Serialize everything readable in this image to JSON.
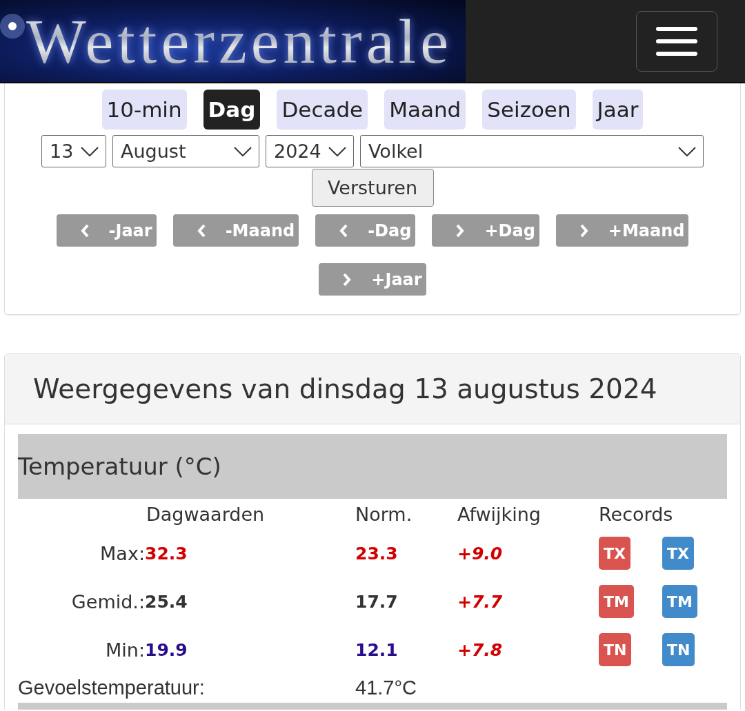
{
  "header": {
    "logo": "Wetterzentrale"
  },
  "period_tabs": [
    {
      "label": "10-min",
      "selected": false
    },
    {
      "label": "Dag",
      "selected": true
    },
    {
      "label": "Decade",
      "selected": false
    },
    {
      "label": "Maand",
      "selected": false
    },
    {
      "label": "Seizoen",
      "selected": false
    },
    {
      "label": "Jaar",
      "selected": false
    }
  ],
  "selects": [
    {
      "value": "13"
    },
    {
      "value": "August"
    },
    {
      "value": "2024"
    },
    {
      "value": "Volkel"
    }
  ],
  "submit_button": "Versturen",
  "nav_buttons": [
    {
      "label": "-Jaar",
      "kind": "prev"
    },
    {
      "label": "-Maand",
      "kind": "prev"
    },
    {
      "label": "-Dag",
      "kind": "prev"
    },
    {
      "label": "+Dag",
      "kind": "next"
    },
    {
      "label": "+Maand",
      "kind": "next"
    },
    {
      "label": "+Jaar",
      "kind": "next"
    }
  ],
  "weather_card": {
    "title": "Weergegevens van dinsdag 13 augustus 2024",
    "section": {
      "title": "Temperatuur (°C)",
      "columns": [
        "Dagwaarden",
        "Norm.",
        "Afwijking",
        "Records"
      ],
      "rows": [
        {
          "label": "Max:",
          "value": "32.3",
          "norm": "23.3",
          "deviation": "+9.0",
          "color": "#d40000",
          "records": [
            {
              "label": "TX",
              "color": "#d9534f"
            },
            {
              "label": "TX",
              "color": "#428bca"
            }
          ]
        },
        {
          "label": "Gemid.:",
          "value": "25.4",
          "norm": "17.7",
          "deviation": "+7.7",
          "color": "#333333",
          "records": [
            {
              "label": "TM",
              "color": "#d9534f"
            },
            {
              "label": "TM",
              "color": "#428bca"
            }
          ]
        },
        {
          "label": "Min:",
          "value": "19.9",
          "norm": "12.1",
          "deviation": "+7.8",
          "color": "#2a0d8f",
          "records": [
            {
              "label": "TN",
              "color": "#d9534f"
            },
            {
              "label": "TN",
              "color": "#428bca"
            }
          ]
        }
      ],
      "feels_like": {
        "label": "Gevoelstemperatuur:",
        "value": "41.7°C"
      }
    }
  }
}
